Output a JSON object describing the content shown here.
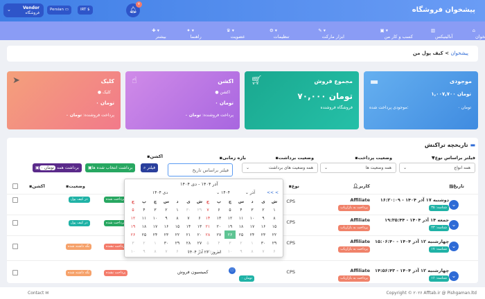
{
  "header": {
    "brand": "پیشخوان فروشگاه",
    "vendor_name": "Vendor",
    "vendor_role": "فروشگاه",
    "lang": "Persian",
    "currency": "IRT",
    "notif_count": "۷"
  },
  "nav": [
    "پیشخوان",
    "آنالیتیکس",
    "کسب و کار من",
    "ابزار مارکت",
    "تنظیمات",
    "عضویت",
    "راهنما",
    "بیشتر"
  ],
  "breadcrumb": {
    "home": "پیشخوان",
    "sep": ">",
    "current": "کیف پول من"
  },
  "cards": {
    "balance": {
      "title": "موجودی",
      "value": "تومان ۱,۰۰۷,۷۰۰",
      "value_sub": "تومان ۰",
      "label": "موجودی پرداخت شده:"
    },
    "sales": {
      "title": "مجموع فروش",
      "value": "تومان ۷۰,۰۰۰",
      "label": "فروشگاه فروشنده"
    },
    "action": {
      "title": "اکشن",
      "sub": "اکشن",
      "value": "تومان ۰",
      "value2": "تومان ۰",
      "label": "پرداخت فروشنده:"
    },
    "click": {
      "title": "کلیک",
      "sub": "کلیک",
      "value": "تومان ۰",
      "value2": "تومان ۰",
      "label": "پرداخت فروشنده:"
    }
  },
  "history": {
    "title": "تاریخچه تراکنش",
    "filters": {
      "type_label": "فیلتر براساس نوع",
      "type_value": "همه انواع",
      "status_label": "وضعیت پرداخت",
      "status_value": "همه وضعیت ها",
      "withdraw_label": "وضعیت برداشت",
      "withdraw_value": "همه وضعیت های برداشت",
      "date_label": "بازه زمانی",
      "date_placeholder": "فیلتر براساس تاریخ",
      "action_label": "اکشن"
    },
    "buttons": {
      "filter": "فیلتر",
      "withdraw_selected": "برداشت انتخاب شده ها",
      "withdraw_all": "برداشت همه",
      "withdraw_all_amount": "تومان ۰"
    },
    "columns": {
      "date": "تاریخ",
      "user": "کاربر",
      "type": "نوع",
      "action": "اکشن",
      "status": "وضعیت"
    },
    "rows": [
      {
        "date": "دوشنبه ۱۷ آذر ۱۴۰۴ - ۱۶:۲۰:۰۹",
        "num": "شناسه: ۳۵",
        "user": "Affiliate",
        "user_tag": "پرداخت به بازاریاب",
        "type": "CPS",
        "status": "پرداخت شده",
        "status2": "در کیف پول"
      },
      {
        "date": "جمعه ۱۴ آذر ۱۴۰۴ - ۱۹:۳۵:۴۴",
        "num": "شناسه: ۲۳",
        "user": "Affiliate",
        "user_tag": "پرداخت به بازاریاب",
        "type": "CPS",
        "status": "پرداخت شده",
        "status2": "در کیف پول"
      },
      {
        "date": "چهارشنبه ۱۲ آذر ۱۴۰۴ - ۱۵:۰۶:۴۰",
        "num": "شناسه: ۱۷",
        "user": "Affiliate",
        "user_tag": "پرداخت به بازاریاب",
        "type": "CPS",
        "status": "پرداخت نشده",
        "status2": "نگه داشته شده"
      },
      {
        "date": "چهارشنبه ۱۲ آذر ۱۴۰۴ - ۱۴:۵۶:۴۳",
        "num": "شناسه: ۱۶",
        "user": "Affiliate",
        "user_tag": "پرداخت به بازاریاب",
        "type": "CPS",
        "status": "پرداخت نشده",
        "status2": "نگه داشته شده",
        "amount": "تومان ۰",
        "commission": "کمیسیون فروش"
      }
    ]
  },
  "calendar": {
    "range": "آذر ۱۴۰۴ - دی ۱۴۰۴",
    "prev": "<< <",
    "month_left": "آذر",
    "year_left": "۱۴۰۴",
    "month_right": "دی ۱۴۰۴",
    "weekdays": [
      "ش",
      "ی",
      "د",
      "س",
      "چ",
      "پ",
      "ج"
    ],
    "left": [
      [
        "۱",
        "۲",
        "۳",
        "۴",
        "۵",
        "۶",
        "۷"
      ],
      [
        "۸",
        "۹",
        "۱۰",
        "۱۱",
        "۱۲",
        "۱۳",
        "۱۴"
      ],
      [
        "۱۵",
        "۱۶",
        "۱۷",
        "۱۸",
        "۱۹",
        "۲۰",
        "۲۱"
      ],
      [
        "۲۲",
        "۲۳",
        "۲۴",
        "۲۵",
        "۲۶",
        "۲۷",
        "۲۸"
      ],
      [
        "۲۹",
        "۳۰",
        "۱",
        "۲",
        "۳",
        "۴",
        "۵"
      ],
      [
        "۶",
        "۷",
        "۸",
        "۹",
        "۱۰",
        "۱۱",
        "۱۲"
      ]
    ],
    "right": [
      [
        "۲۹",
        "۳۰",
        "۱",
        "۲",
        "۳",
        "۴",
        "۵"
      ],
      [
        "۶",
        "۷",
        "۸",
        "۹",
        "۱۰",
        "۱۱",
        "۱۲"
      ],
      [
        "۱۳",
        "۱۴",
        "۱۵",
        "۱۶",
        "۱۷",
        "۱۸",
        "۱۹"
      ],
      [
        "۲۰",
        "۲۱",
        "۲۲",
        "۲۳",
        "۲۴",
        "۲۵",
        "۲۶"
      ],
      [
        "۲۷",
        "۲۸",
        "۲۹",
        "۳۰",
        "۱",
        "۲",
        "۳"
      ],
      [
        "۴",
        "۵",
        "۶",
        "۷",
        "۸",
        "۹",
        "۱۰"
      ]
    ],
    "today": "امروز: ۲۶ آذر ۱۴۰۴"
  },
  "footer": {
    "copyright": "Copyright © ۲۰۲۶ Afftab.ir @ Pishgaman.ltd",
    "contact": "Contact"
  },
  "colors": {
    "primary": "#3f7fe6",
    "nav": "#8a9cf5",
    "teal": "#1fb2a6",
    "green": "#27a761"
  }
}
